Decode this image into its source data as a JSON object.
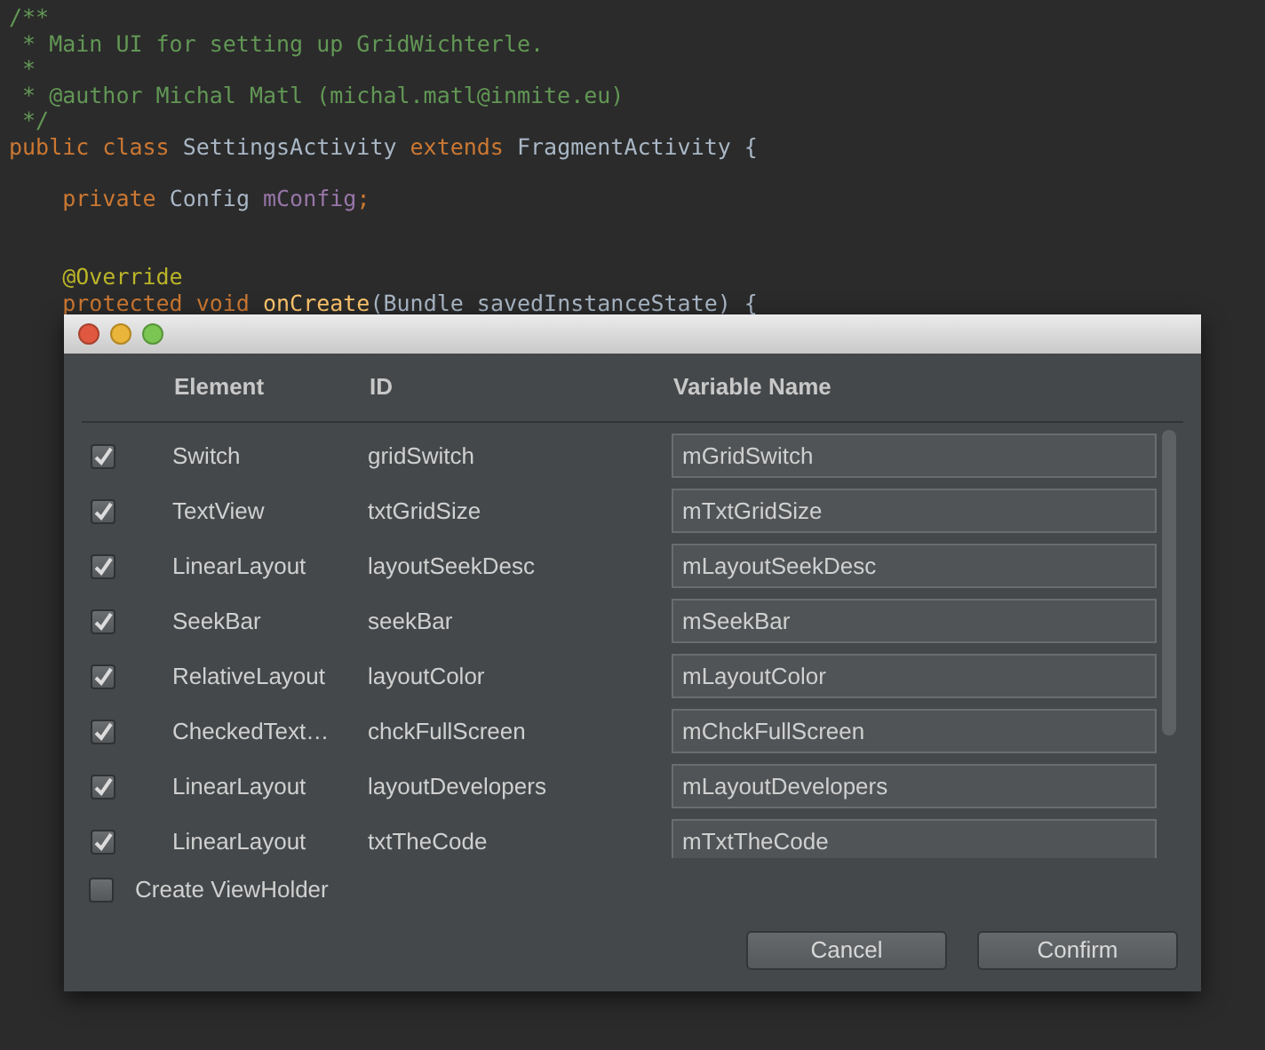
{
  "editor": {
    "lines": [
      [
        {
          "kind": "comment",
          "text": "/**"
        }
      ],
      [
        {
          "kind": "comment",
          "text": " * Main UI for setting up GridWichterle."
        }
      ],
      [
        {
          "kind": "comment",
          "text": " *"
        }
      ],
      [
        {
          "kind": "comment",
          "text": " * @author Michal Matl (michal.matl@inmite.eu)"
        }
      ],
      [
        {
          "kind": "comment",
          "text": " */"
        }
      ],
      [
        {
          "kind": "keyword",
          "text": "public class "
        },
        {
          "kind": "plain",
          "text": "SettingsActivity "
        },
        {
          "kind": "keyword",
          "text": "extends "
        },
        {
          "kind": "plain",
          "text": "FragmentActivity {"
        }
      ],
      {
        "blank_before": true,
        "tokens": [
          {
            "kind": "keyword",
            "text": "    private "
          },
          {
            "kind": "plain",
            "text": "Config "
          },
          {
            "kind": "field",
            "text": "mConfig"
          },
          {
            "kind": "keyword",
            "text": ";"
          }
        ]
      },
      {
        "blank_before": true,
        "wide_blank": true,
        "tokens": [
          {
            "kind": "annotation",
            "text": "    @Override"
          }
        ]
      },
      [
        {
          "kind": "keyword",
          "text": "    protected void "
        },
        {
          "kind": "method",
          "text": "onCreate"
        },
        {
          "kind": "plain",
          "text": "(Bundle savedInstanceState) {"
        }
      ]
    ]
  },
  "dialog": {
    "columns": [
      "Element",
      "ID",
      "Variable Name"
    ],
    "rows": [
      {
        "checked": true,
        "element": "Switch",
        "id": "gridSwitch",
        "variable": "mGridSwitch"
      },
      {
        "checked": true,
        "element": "TextView",
        "id": "txtGridSize",
        "variable": "mTxtGridSize"
      },
      {
        "checked": true,
        "element": "LinearLayout",
        "id": "layoutSeekDesc",
        "variable": "mLayoutSeekDesc"
      },
      {
        "checked": true,
        "element": "SeekBar",
        "id": "seekBar",
        "variable": "mSeekBar"
      },
      {
        "checked": true,
        "element": "RelativeLayout",
        "id": "layoutColor",
        "variable": "mLayoutColor"
      },
      {
        "checked": true,
        "element": "CheckedText…",
        "id": "chckFullScreen",
        "variable": "mChckFullScreen"
      },
      {
        "checked": true,
        "element": "LinearLayout",
        "id": "layoutDevelopers",
        "variable": "mLayoutDevelopers"
      },
      {
        "checked": true,
        "element": "LinearLayout",
        "id": "txtTheCode",
        "variable": "mTxtTheCode"
      }
    ],
    "option": {
      "label": "Create ViewHolder",
      "checked": false
    },
    "buttons": [
      "Cancel",
      "Confirm"
    ]
  }
}
